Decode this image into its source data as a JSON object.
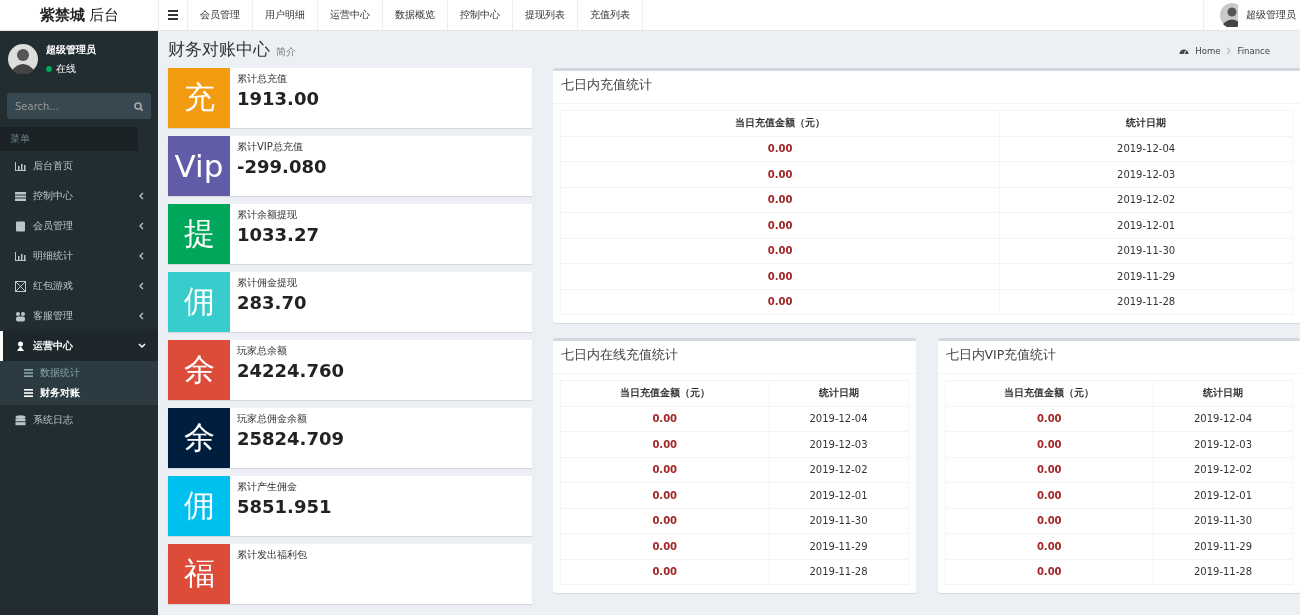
{
  "header": {
    "logo_bold": "紫禁城",
    "logo_light": "后台",
    "nav": [
      {
        "label": "会员管理"
      },
      {
        "label": "用户明细"
      },
      {
        "label": "运营中心"
      },
      {
        "label": "数据概览"
      },
      {
        "label": "控制中心"
      },
      {
        "label": "提现列表"
      },
      {
        "label": "充值列表"
      }
    ],
    "user_name": "超级管理员"
  },
  "sidebar": {
    "user_name": "超级管理员",
    "status": "在线",
    "search": {
      "placeholder": "Search..."
    },
    "section_label": "菜单",
    "items": [
      {
        "label": "后台首页",
        "kind": "link",
        "expanded": false
      },
      {
        "label": "控制中心",
        "kind": "tree",
        "expanded": false
      },
      {
        "label": "会员管理",
        "kind": "tree",
        "expanded": false
      },
      {
        "label": "明细统计",
        "kind": "tree",
        "expanded": false
      },
      {
        "label": "红包游戏",
        "kind": "tree",
        "expanded": false
      },
      {
        "label": "客服管理",
        "kind": "tree",
        "expanded": false
      },
      {
        "label": "运营中心",
        "kind": "tree",
        "expanded": true,
        "children": [
          {
            "label": "数据统计",
            "selected": false
          },
          {
            "label": "财务对账",
            "selected": true
          }
        ]
      },
      {
        "label": "系统日志",
        "kind": "link",
        "expanded": false
      }
    ]
  },
  "page": {
    "title": "财务对账中心",
    "subtitle": "简介",
    "breadcrumb": [
      "Home",
      "Finance"
    ]
  },
  "stats": [
    {
      "icon": "充",
      "color": "#f39c12",
      "label": "累计总充值",
      "value": "1913.00"
    },
    {
      "icon": "Vip",
      "color": "#605ca8",
      "label": "累计VIP总充值",
      "value": "-299.080"
    },
    {
      "icon": "提",
      "color": "#00a65a",
      "label": "累计余额提现",
      "value": "1033.27"
    },
    {
      "icon": "佣",
      "color": "#39cccc",
      "label": "累计佣金提现",
      "value": "283.70"
    },
    {
      "icon": "余",
      "color": "#dd4b39",
      "label": "玩家总余额",
      "value": "24224.760"
    },
    {
      "icon": "余",
      "color": "#001f3f",
      "label": "玩家总佣金余额",
      "value": "25824.709"
    },
    {
      "icon": "佣",
      "color": "#00c0ef",
      "label": "累计产生佣金",
      "value": "5851.951"
    },
    {
      "icon": "福",
      "color": "#dd4b39",
      "label": "累计发出福利包"
    }
  ],
  "tables": [
    {
      "title": "七日内充值统计",
      "columns": [
        "当日充值金额（元）",
        "统计日期"
      ],
      "rows": [
        [
          "0.00",
          "2019-12-04"
        ],
        [
          "0.00",
          "2019-12-03"
        ],
        [
          "0.00",
          "2019-12-02"
        ],
        [
          "0.00",
          "2019-12-01"
        ],
        [
          "0.00",
          "2019-11-30"
        ],
        [
          "0.00",
          "2019-11-29"
        ],
        [
          "0.00",
          "2019-11-28"
        ]
      ]
    },
    {
      "title": "七日内在线充值统计",
      "columns": [
        "当日充值金额（元）",
        "统计日期"
      ],
      "rows": [
        [
          "0.00",
          "2019-12-04"
        ],
        [
          "0.00",
          "2019-12-03"
        ],
        [
          "0.00",
          "2019-12-02"
        ],
        [
          "0.00",
          "2019-12-01"
        ],
        [
          "0.00",
          "2019-11-30"
        ],
        [
          "0.00",
          "2019-11-29"
        ],
        [
          "0.00",
          "2019-11-28"
        ]
      ]
    },
    {
      "title": "七日内VIP充值统计",
      "columns": [
        "当日充值金额（元）",
        "统计日期"
      ],
      "rows": [
        [
          "0.00",
          "2019-12-04"
        ],
        [
          "0.00",
          "2019-12-03"
        ],
        [
          "0.00",
          "2019-12-02"
        ],
        [
          "0.00",
          "2019-12-01"
        ],
        [
          "0.00",
          "2019-11-30"
        ],
        [
          "0.00",
          "2019-11-29"
        ],
        [
          "0.00",
          "2019-11-28"
        ]
      ]
    }
  ]
}
